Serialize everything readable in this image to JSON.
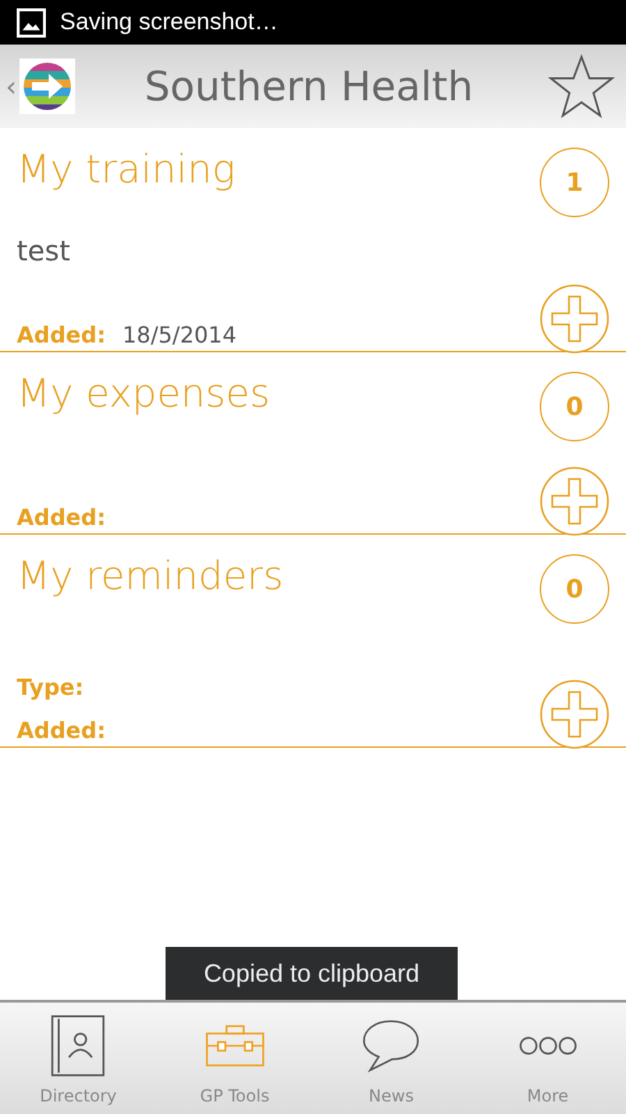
{
  "status_bar": {
    "text": "Saving screenshot…"
  },
  "header": {
    "back": "‹",
    "title": "Southern Health",
    "favorite": false
  },
  "sections": [
    {
      "title": "My training",
      "count": "1",
      "body": "test",
      "fields": [
        {
          "label": "Added:",
          "value": "18/5/2014"
        }
      ]
    },
    {
      "title": "My expenses",
      "count": "0",
      "fields": [
        {
          "label": "Added:"
        }
      ]
    },
    {
      "title": "My reminders",
      "count": "0",
      "fields": [
        {
          "label": "Type:"
        },
        {
          "label": "Added:"
        }
      ]
    }
  ],
  "toast": "Copied to clipboard",
  "tabs": [
    {
      "label": "Directory",
      "kind": "directory",
      "selected": false
    },
    {
      "label": "GP Tools",
      "kind": "tools",
      "selected": true
    },
    {
      "label": "News",
      "kind": "news",
      "selected": false
    },
    {
      "label": "More",
      "kind": "more",
      "selected": false
    }
  ]
}
